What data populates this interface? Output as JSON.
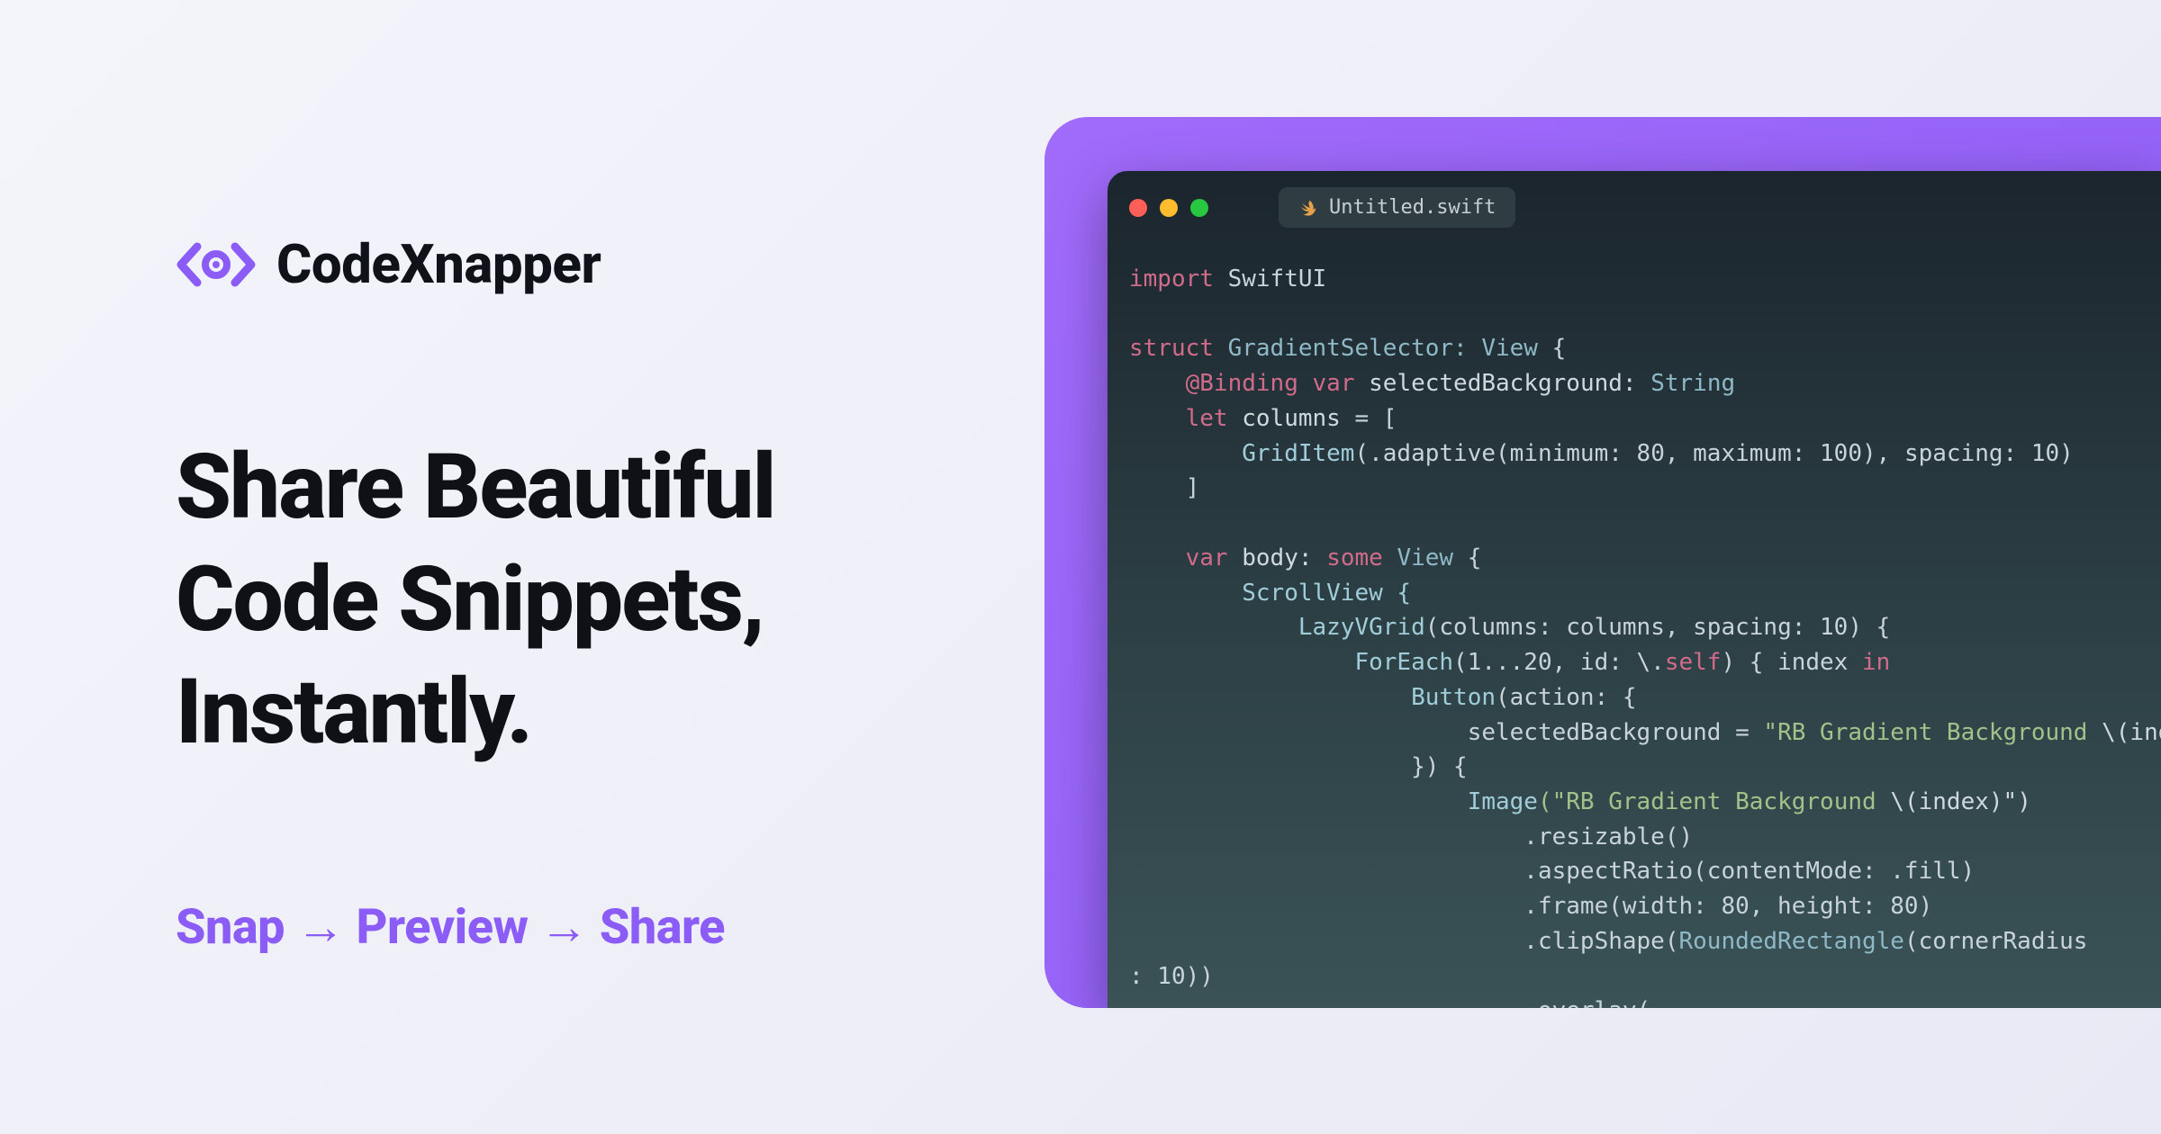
{
  "brand": {
    "name": "CodeXnapper"
  },
  "headline": "Share Beautiful\nCode Snippets,\nInstantly.",
  "tagline": {
    "step1": "Snap",
    "step2": "Preview",
    "step3": "Share",
    "arrow": "→"
  },
  "editor": {
    "filename": "Untitled.swift",
    "traffic": {
      "red": "#ff5f57",
      "yellow": "#febc2e",
      "green": "#28c840"
    },
    "code": {
      "l1_kw": "import",
      "l1_mod": "SwiftUI",
      "l2_kw": "struct",
      "l2_name": "GradientSelector:",
      "l2_type": "View",
      "l2_brace": "{",
      "l3_at": "@Binding",
      "l3_var": "var",
      "l3_name": "selectedBackground:",
      "l3_type": "String",
      "l4_let": "let",
      "l4_name": "columns",
      "l4_eq": "= [",
      "l5_call": "GridItem",
      "l5_args": "(.adaptive(minimum: 80, maximum: 100), spacing: 10)",
      "l6": "]",
      "l7_var": "var",
      "l7_name": "body:",
      "l7_some": "some",
      "l7_type": "View",
      "l7_brace": "{",
      "l8": "ScrollView {",
      "l9_call": "LazyVGrid",
      "l9_args": "(columns: columns, spacing: 10) {",
      "l10_call": "ForEach",
      "l10_args": "(1...20, id: \\.",
      "l10_self": "self",
      "l10_close": ") { index ",
      "l10_in": "in",
      "l11_call": "Button",
      "l11_args": "(action: {",
      "l12_lhs": "selectedBackground =",
      "l12_str": "\"RB Gradient Background ",
      "l12_interp": "\\(index)\"",
      "l13": "}) {",
      "l14_call": "Image",
      "l14_str": "(\"RB Gradient Background ",
      "l14_interp": "\\(index)\")",
      "l15": ".resizable()",
      "l16": ".aspectRatio(contentMode: .fill)",
      "l17": ".frame(width: 80, height: 80)",
      "l18_call": ".clipShape(",
      "l18_type": "RoundedRectangle",
      "l18_args": "(cornerRadius",
      "l19": ": 10))",
      "l20": ".overlay(…"
    }
  }
}
